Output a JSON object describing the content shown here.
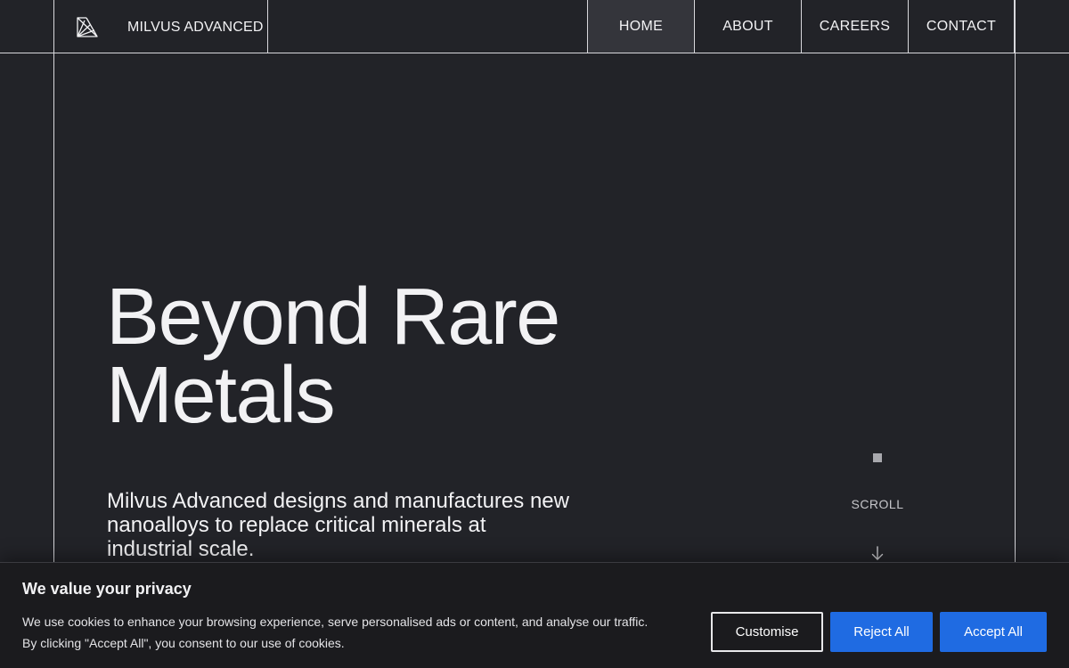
{
  "brand": {
    "name": "MILVUS ADVANCED",
    "logo_icon": "angular-fan-logo-icon"
  },
  "nav": {
    "items": [
      {
        "label": "HOME",
        "active": true
      },
      {
        "label": "ABOUT",
        "active": false
      },
      {
        "label": "CAREERS",
        "active": false
      },
      {
        "label": "CONTACT",
        "active": false
      }
    ]
  },
  "hero": {
    "title_line1": "Beyond Rare",
    "title_line2": "Metals",
    "subtitle": "Milvus Advanced designs and manufactures new nanoalloys to replace critical minerals at industrial scale."
  },
  "scroll": {
    "label": "SCROLL",
    "icon": "arrow-down-icon"
  },
  "cookie": {
    "title": "We value your privacy",
    "text": "We use cookies to enhance your browsing experience, serve personalised ads or content, and analyse our traffic. By clicking \"Accept All\", you consent to our use of cookies.",
    "customise_label": "Customise",
    "reject_label": "Reject All",
    "accept_label": "Accept All"
  },
  "colors": {
    "background": "#222328",
    "line": "#d8d8dc",
    "active_nav": "#34353b",
    "button_blue": "#1f6be2",
    "banner": "#1b1b1e"
  }
}
